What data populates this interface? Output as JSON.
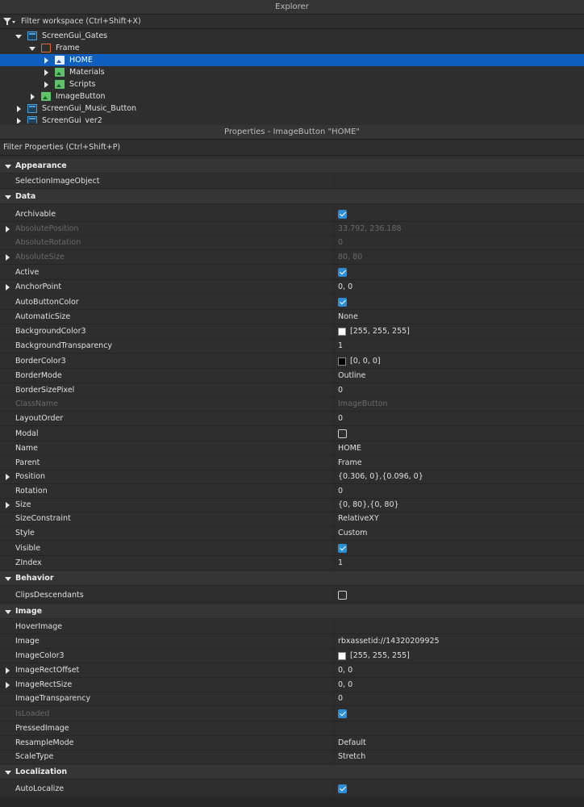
{
  "explorer": {
    "title": "Explorer",
    "filter_placeholder": "Filter workspace (Ctrl+Shift+X)",
    "items": [
      {
        "label": "ScreenGui_Gates",
        "icon": "screengui-icon",
        "expand": "down"
      },
      {
        "label": "Frame",
        "icon": "frame-icon",
        "expand": "down"
      },
      {
        "label": "HOME",
        "icon": "imagebutton-icon",
        "expand": "right",
        "selected": true
      },
      {
        "label": "Materials",
        "icon": "imagebutton-icon",
        "expand": "right"
      },
      {
        "label": "Scripts",
        "icon": "imagebutton-icon",
        "expand": "right"
      },
      {
        "label": "ImageButton",
        "icon": "imagebutton-icon",
        "expand": "right"
      },
      {
        "label": "ScreenGui_Music_Button",
        "icon": "screengui-icon",
        "expand": "right"
      },
      {
        "label": "ScreenGui_ver2",
        "icon": "screengui-icon",
        "expand": "right"
      }
    ]
  },
  "properties": {
    "title": "Properties - ImageButton \"HOME\"",
    "filter_placeholder": "Filter Properties (Ctrl+Shift+P)",
    "categories": {
      "appearance": "Appearance",
      "data": "Data",
      "behavior": "Behavior",
      "image": "Image",
      "localization": "Localization"
    },
    "rows": {
      "selection_image_object": {
        "name": "SelectionImageObject",
        "value": ""
      },
      "archivable": {
        "name": "Archivable",
        "checked": true
      },
      "absolute_position": {
        "name": "AbsolutePosition",
        "value": "33.792, 236.188"
      },
      "absolute_rotation": {
        "name": "AbsoluteRotation",
        "value": "0"
      },
      "absolute_size": {
        "name": "AbsoluteSize",
        "value": "80, 80"
      },
      "active": {
        "name": "Active",
        "checked": true
      },
      "anchor_point": {
        "name": "AnchorPoint",
        "value": "0, 0"
      },
      "auto_button_color": {
        "name": "AutoButtonColor",
        "checked": true
      },
      "automatic_size": {
        "name": "AutomaticSize",
        "value": "None"
      },
      "background_color3": {
        "name": "BackgroundColor3",
        "value": "[255, 255, 255]",
        "swatch": "#ffffff"
      },
      "background_transparency": {
        "name": "BackgroundTransparency",
        "value": "1"
      },
      "border_color3": {
        "name": "BorderColor3",
        "value": "[0, 0, 0]",
        "swatch": "#000000"
      },
      "border_mode": {
        "name": "BorderMode",
        "value": "Outline"
      },
      "border_size_pixel": {
        "name": "BorderSizePixel",
        "value": "0"
      },
      "class_name": {
        "name": "ClassName",
        "value": "ImageButton"
      },
      "layout_order": {
        "name": "LayoutOrder",
        "value": "0"
      },
      "modal": {
        "name": "Modal",
        "checked": false
      },
      "name": {
        "name": "Name",
        "value": "HOME"
      },
      "parent": {
        "name": "Parent",
        "value": "Frame"
      },
      "position": {
        "name": "Position",
        "value": "{0.306, 0},{0.096, 0}"
      },
      "rotation": {
        "name": "Rotation",
        "value": "0"
      },
      "size": {
        "name": "Size",
        "value": "{0, 80},{0, 80}"
      },
      "size_constraint": {
        "name": "SizeConstraint",
        "value": "RelativeXY"
      },
      "style": {
        "name": "Style",
        "value": "Custom"
      },
      "visible": {
        "name": "Visible",
        "checked": true
      },
      "zindex": {
        "name": "ZIndex",
        "value": "1"
      },
      "clips_descendants": {
        "name": "ClipsDescendants",
        "checked": false
      },
      "hover_image": {
        "name": "HoverImage",
        "value": ""
      },
      "image": {
        "name": "Image",
        "value": "rbxassetid://14320209925"
      },
      "image_color3": {
        "name": "ImageColor3",
        "value": "[255, 255, 255]",
        "swatch": "#ffffff"
      },
      "image_rect_offset": {
        "name": "ImageRectOffset",
        "value": "0, 0"
      },
      "image_rect_size": {
        "name": "ImageRectSize",
        "value": "0, 0"
      },
      "image_transparency": {
        "name": "ImageTransparency",
        "value": "0"
      },
      "is_loaded": {
        "name": "IsLoaded",
        "checked": true
      },
      "pressed_image": {
        "name": "PressedImage",
        "value": ""
      },
      "resample_mode": {
        "name": "ResampleMode",
        "value": "Default"
      },
      "scale_type": {
        "name": "ScaleType",
        "value": "Stretch"
      },
      "auto_localize": {
        "name": "AutoLocalize",
        "checked": true
      }
    }
  }
}
